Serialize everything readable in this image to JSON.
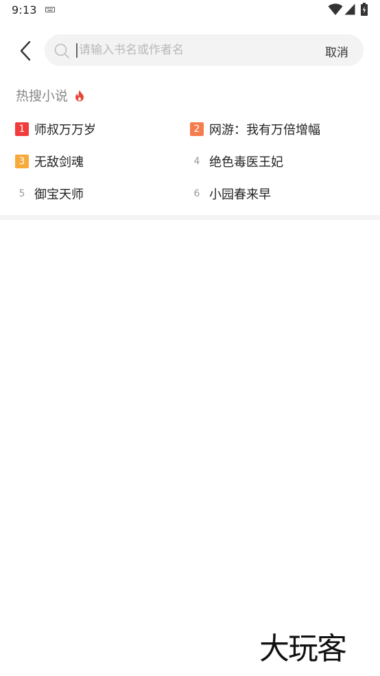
{
  "status_bar": {
    "time": "9:13",
    "icons": [
      "keyboard-icon",
      "wifi-icon",
      "signal-icon",
      "battery-icon"
    ]
  },
  "search": {
    "placeholder": "请输入书名或作者名",
    "value": "",
    "cancel_label": "取消"
  },
  "hot": {
    "title": "热搜小说",
    "title_icon": "flame-icon",
    "items": [
      {
        "rank": "1",
        "title": "师叔万万岁",
        "badge_color": "#f23b3b"
      },
      {
        "rank": "2",
        "title": "网游：我有万倍增幅",
        "badge_color": "#f57c4c"
      },
      {
        "rank": "3",
        "title": "无敌剑魂",
        "badge_color": "#f7a93a"
      },
      {
        "rank": "4",
        "title": "绝色毒医王妃"
      },
      {
        "rank": "5",
        "title": "御宝天师"
      },
      {
        "rank": "6",
        "title": "小园春来早"
      }
    ]
  },
  "watermark": {
    "text": "大玩客"
  },
  "colors": {
    "flame": "#e8463a",
    "search_bg": "#f3f3f3",
    "divider": "#f4f4f4"
  }
}
